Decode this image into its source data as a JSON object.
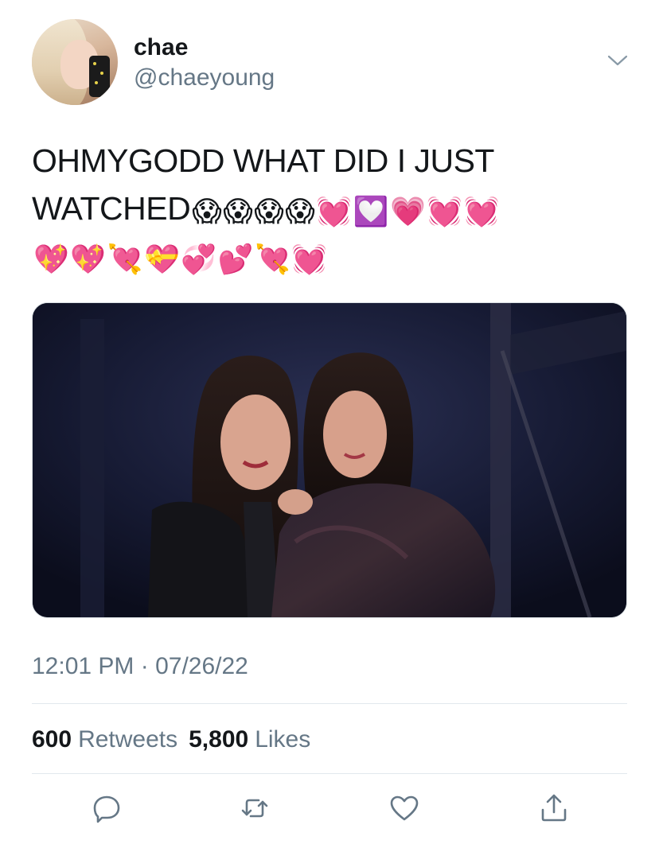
{
  "author": {
    "display_name": "chae",
    "handle": "@chaeyoung"
  },
  "tweet": {
    "text_line_1": "OHMYGODD WHAT DID I JUST",
    "text_line_2": "WATCHED",
    "emoji_line_2": [
      "😱",
      "😱",
      "😱",
      "😱",
      "💓",
      "💟",
      "💗",
      "💓",
      "💓"
    ],
    "emoji_line_3": [
      "💖",
      "💖",
      "💘",
      "💝",
      "💞",
      "💕",
      "💘",
      "💓"
    ]
  },
  "timestamp": "12:01 PM · 07/26/22",
  "stats": {
    "retweets_count": "600",
    "retweets_label": "Retweets",
    "likes_count": "5,800",
    "likes_label": "Likes"
  },
  "icons": {
    "menu": "chevron-down-icon",
    "reply": "reply-icon",
    "retweet": "retweet-icon",
    "like": "heart-icon",
    "share": "share-icon"
  },
  "colors": {
    "text_primary": "#14171a",
    "text_secondary": "#657786",
    "divider": "#e1e8ed",
    "icon": "#657786"
  }
}
